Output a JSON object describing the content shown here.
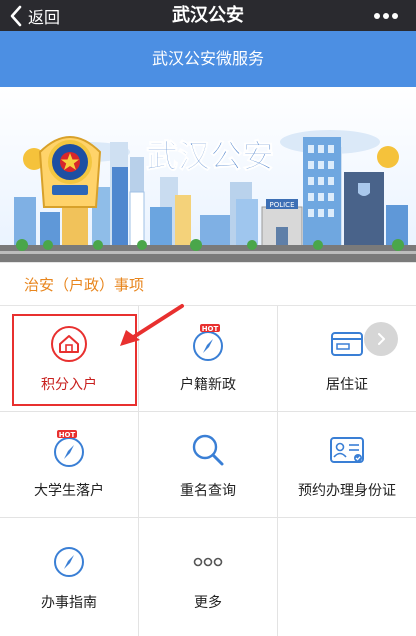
{
  "nav": {
    "back_label": "返回",
    "title": "武汉公安"
  },
  "subheader": {
    "title": "武汉公安微服务"
  },
  "banner": {
    "brand_text": "武汉公安",
    "police_sign": "POLICE"
  },
  "section": {
    "title": "治安（户政）事项"
  },
  "services": [
    {
      "label": "积分入户",
      "icon": "house-icon",
      "hot": false
    },
    {
      "label": "户籍新政",
      "icon": "compass-icon",
      "hot": true
    },
    {
      "label": "居住证",
      "icon": "card-icon",
      "hot": false
    },
    {
      "label": "大学生落户",
      "icon": "compass-icon",
      "hot": true
    },
    {
      "label": "重名查询",
      "icon": "search-icon",
      "hot": false
    },
    {
      "label": "预约办理身份证",
      "icon": "id-card-icon",
      "hot": false
    },
    {
      "label": "办事指南",
      "icon": "compass-icon",
      "hot": false
    },
    {
      "label": "更多",
      "icon": "more-dots-icon",
      "hot": false
    }
  ],
  "hot_badge": "HOT",
  "colors": {
    "nav_bg": "#2a2a2f",
    "subheader_bg": "#4c8fe3",
    "section_title": "#e8861e",
    "icon_blue": "#3a7fd5",
    "highlight_red": "#e8302f"
  }
}
